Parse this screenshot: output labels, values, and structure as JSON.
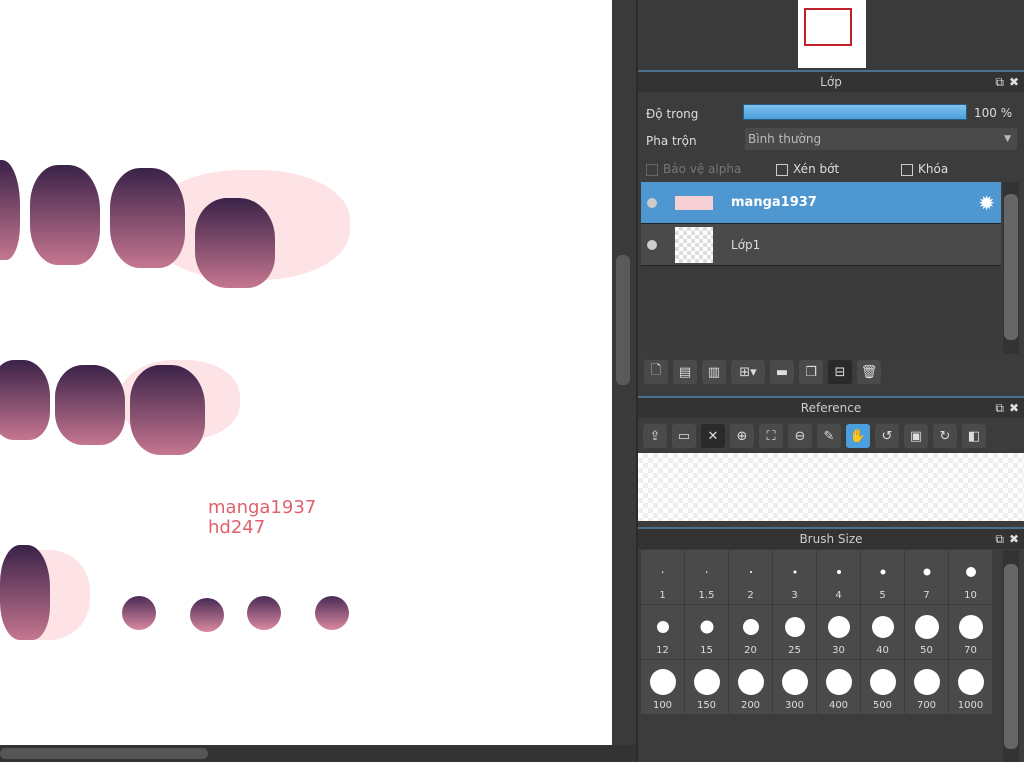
{
  "canvas": {
    "watermark_line1": "manga1937",
    "watermark_line2": "hd247"
  },
  "layers_panel": {
    "title": "Lớp",
    "opacity_label": "Độ trong",
    "opacity_value": "100 %",
    "opacity_fraction": 1.0,
    "blend_label": "Pha trộn",
    "blend_value": "Bình thường",
    "protect_alpha": "Bảo vệ alpha",
    "clip": "Xén bớt",
    "lock": "Khóa",
    "layers": [
      {
        "name": "manga1937",
        "selected": true
      },
      {
        "name": "Lớp1",
        "selected": false
      }
    ]
  },
  "reference_panel": {
    "title": "Reference"
  },
  "brush_panel": {
    "title": "Brush Size",
    "sizes": [
      "1",
      "1.5",
      "2",
      "3",
      "4",
      "5",
      "7",
      "10",
      "12",
      "15",
      "20",
      "25",
      "30",
      "40",
      "50",
      "70",
      "100",
      "150",
      "200",
      "300",
      "400",
      "500",
      "700",
      "1000"
    ]
  },
  "colors": {
    "accent": "#4a9fdc",
    "selected_layer": "#4f97d1"
  }
}
